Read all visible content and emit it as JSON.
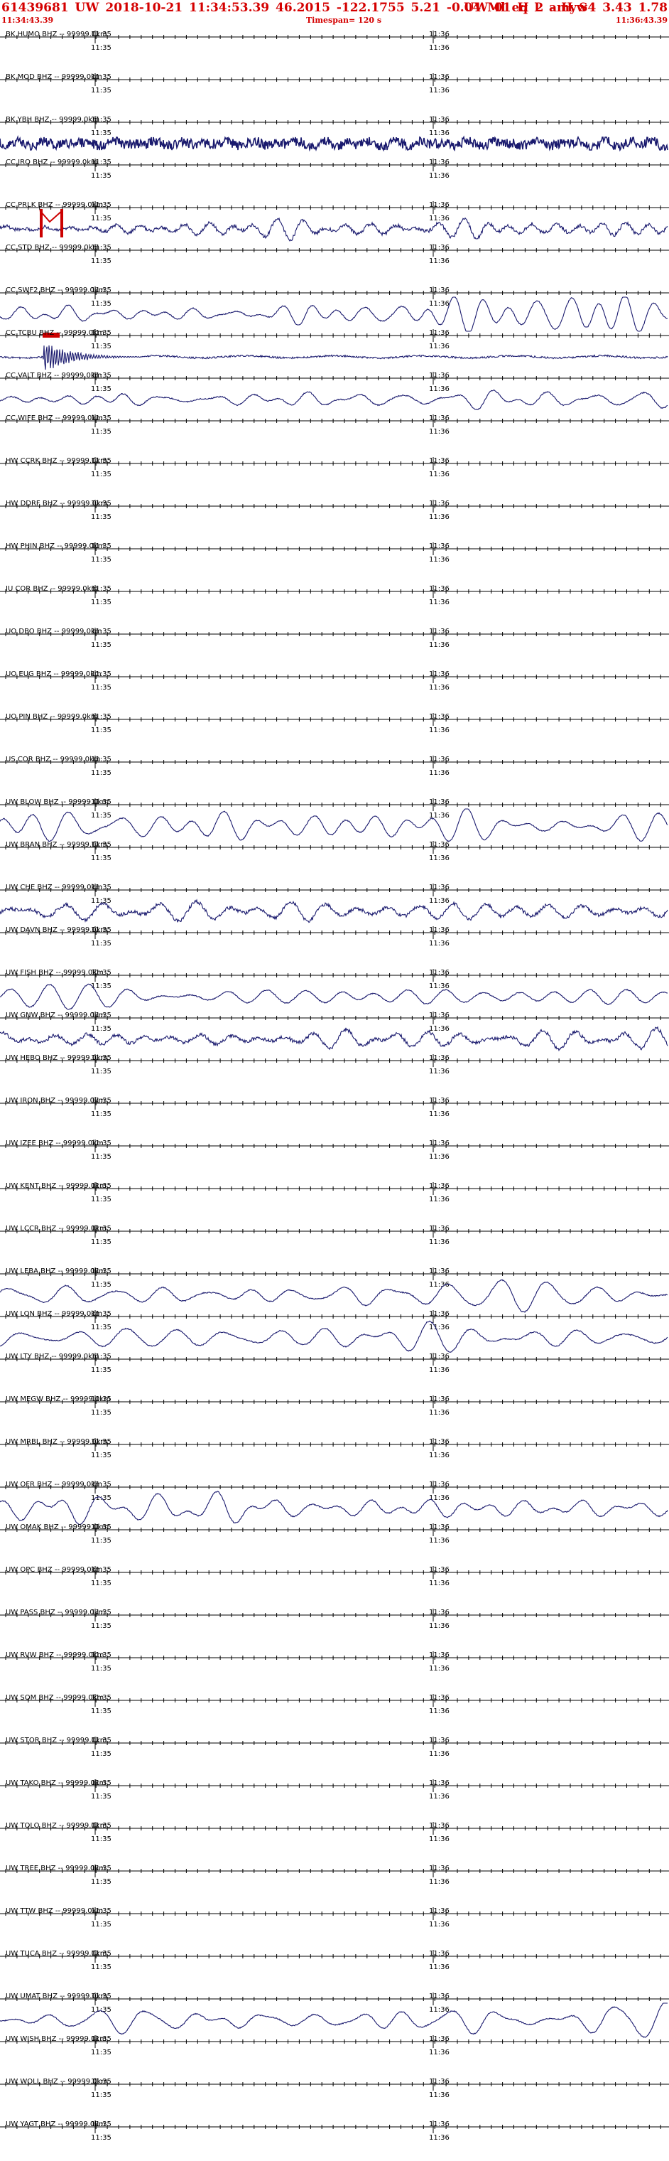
{
  "header": {
    "title": "61439681 UW 2018-10-21 11:34:53.39   46.2015 -122.1755   5.21 -0.04 Ml  eq  L  amyw",
    "right_info": "UW 01  H   2   -  H S4    3.43  1.78",
    "start_time": "11:34:43.39",
    "timespan": "Timespan= 120 s",
    "end_time": "11:36:43.39"
  },
  "chart_data": {
    "type": "line",
    "title": "61439681 UW 2018-10-21 11:34:53.39   46.2015 -122.1755   5.21 -0.04 Ml  eq  L  amyw",
    "x_unit": "time",
    "xlim": [
      "11:34:43.39",
      "11:36:43.39"
    ],
    "timespan_s": 120,
    "tick_labels": [
      "11:35",
      "11:36"
    ],
    "colors": {
      "trace": "#1a1a6e",
      "axis": "#000000",
      "header": "#d40000",
      "pick": "#cc0000"
    },
    "stations": [
      {
        "label": "BK HUMO BHZ -- 99999.0km",
        "signal": "none"
      },
      {
        "label": "BK MOD BHZ -- 99999.0km",
        "signal": "none"
      },
      {
        "label": "BK YBH BHZ -- 99999.0km",
        "signal": "noise"
      },
      {
        "label": "CC JRO BHZ -- 99999.0km",
        "signal": "none"
      },
      {
        "label": "CC PRLK BHZ -- 99999.0km",
        "signal": "wave_noise",
        "pick": true
      },
      {
        "label": "CC STD BHZ -- 99999.0km",
        "signal": "none"
      },
      {
        "label": "CC SWF2 BHZ -- 99999.0km",
        "signal": "wave"
      },
      {
        "label": "CC TCBU BHZ -- 99999.0km",
        "signal": "event",
        "pick": true
      },
      {
        "label": "CC VALT BHZ -- 99999.0km",
        "signal": "wave"
      },
      {
        "label": "CC WIFE BHZ -- 99999.0km",
        "signal": "none"
      },
      {
        "label": "HW CCRK BHZ -- 99999.0km",
        "signal": "none"
      },
      {
        "label": "HW DDRF BHZ -- 99999.0km",
        "signal": "none"
      },
      {
        "label": "HW PHIN BHZ -- 99999.0km",
        "signal": "none"
      },
      {
        "label": "IU COR BHZ -- 99999.0km",
        "signal": "none"
      },
      {
        "label": "UO DBO BHZ -- 99999.0km",
        "signal": "none"
      },
      {
        "label": "UO EUG BHZ -- 99999.0km",
        "signal": "none"
      },
      {
        "label": "UO PIN BHZ -- 99999.0km",
        "signal": "none"
      },
      {
        "label": "US COR BHZ -- 99999.0km",
        "signal": "none"
      },
      {
        "label": "UW BLOW BHZ -- 99999.0km",
        "signal": "wave"
      },
      {
        "label": "UW BRAN BHZ -- 99999.0km",
        "signal": "none"
      },
      {
        "label": "UW CHE BHZ -- 99999.0km",
        "signal": "wave_noise"
      },
      {
        "label": "UW DAVN BHZ -- 99999.0km",
        "signal": "none"
      },
      {
        "label": "UW FISH BHZ -- 99999.0km",
        "signal": "wave"
      },
      {
        "label": "UW GNW BHZ -- 99999.0km",
        "signal": "wave_noise"
      },
      {
        "label": "UW HEBO BHZ -- 99999.0km",
        "signal": "none"
      },
      {
        "label": "UW IRON BHZ -- 99999.0km",
        "signal": "none"
      },
      {
        "label": "UW IZEE BHZ -- 99999.0km",
        "signal": "none"
      },
      {
        "label": "UW KENT BHZ -- 99999.0km",
        "signal": "none"
      },
      {
        "label": "UW LCCR BHZ -- 99999.0km",
        "signal": "none"
      },
      {
        "label": "UW LEBA BHZ -- 99999.0km",
        "signal": "wave"
      },
      {
        "label": "UW LON BHZ -- 99999.0km",
        "signal": "wave"
      },
      {
        "label": "UW LTY BHZ -- 99999.0km",
        "signal": "none"
      },
      {
        "label": "UW MEGW BHZ -- 99999.0km",
        "signal": "none"
      },
      {
        "label": "UW MRBL BHZ -- 99999.0km",
        "signal": "none"
      },
      {
        "label": "UW OFR BHZ -- 99999.0km",
        "signal": "wave"
      },
      {
        "label": "UW OMAK BHZ -- 99999.0km",
        "signal": "none"
      },
      {
        "label": "UW OPC BHZ -- 99999.0km",
        "signal": "none"
      },
      {
        "label": "UW PASS BHZ -- 99999.0km",
        "signal": "none"
      },
      {
        "label": "UW RVW BHZ -- 99999.0km",
        "signal": "none"
      },
      {
        "label": "UW SQM BHZ -- 99999.0km",
        "signal": "none"
      },
      {
        "label": "UW STOR BHZ -- 99999.0km",
        "signal": "none"
      },
      {
        "label": "UW TAKO BHZ -- 99999.0km",
        "signal": "none"
      },
      {
        "label": "UW TOLO BHZ -- 99999.0km",
        "signal": "none"
      },
      {
        "label": "UW TREE BHZ -- 99999.0km",
        "signal": "none"
      },
      {
        "label": "UW TTW BHZ -- 99999.0km",
        "signal": "none"
      },
      {
        "label": "UW TUCA BHZ -- 99999.0km",
        "signal": "none"
      },
      {
        "label": "UW UMAT BHZ -- 99999.0km",
        "signal": "wave"
      },
      {
        "label": "UW WISH BHZ -- 99999.0km",
        "signal": "none"
      },
      {
        "label": "UW WOLL BHZ -- 99999.0km",
        "signal": "none"
      },
      {
        "label": "UW YAGT BHZ -- 99999.0km",
        "signal": "none"
      }
    ]
  }
}
